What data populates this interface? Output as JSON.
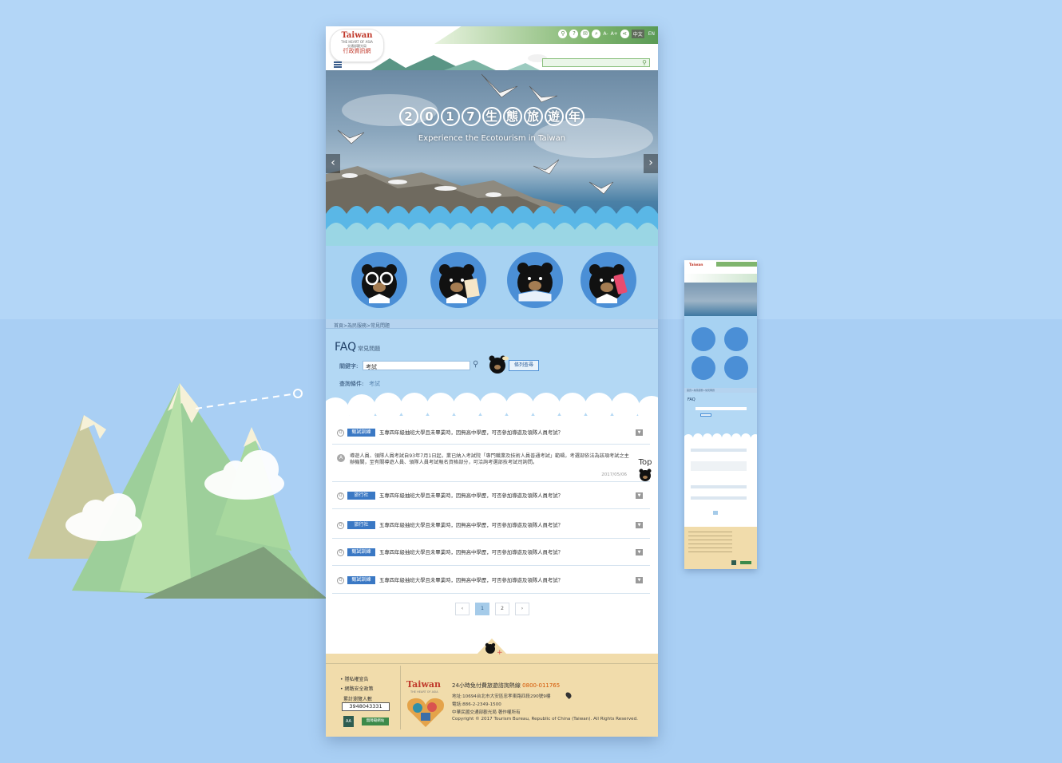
{
  "header": {
    "logo_title": "Taiwan",
    "logo_sub": "THE HEART OF ASIA",
    "logo_sub2": "交通部觀光局",
    "logo_caption": "行政資訊網",
    "lang_zh": "中文",
    "lang_en": "EN",
    "font_small": "A-",
    "font_large": "A+",
    "search_placeholder": ""
  },
  "hero": {
    "title_chars": [
      "2",
      "0",
      "1",
      "7",
      "生",
      "態",
      "旅",
      "遊",
      "年"
    ],
    "subtitle": "Experience the Ecotourism in Taiwan",
    "prev": "‹",
    "next": "›"
  },
  "breadcrumb": "首頁>為民服務>常見問題",
  "faq": {
    "title": "FAQ",
    "subtitle": "常見問題",
    "keyword_label": "關鍵字:",
    "keyword_value": "考試",
    "operation_label": "查詢條件:",
    "operation_value": "考試",
    "list_button": "條列查尋",
    "items": [
      {
        "tag": "甄試訓練",
        "question": "五專四年級抽班大學且未畢業時，因無高中學歷，可否參加導遊及領隊人員考試？"
      },
      {
        "tag": "旅行社",
        "question": "五專四年級抽班大學且未畢業時，因無高中學歷，可否參加導遊及領隊人員考試？"
      },
      {
        "tag": "旅行社",
        "question": "五專四年級抽班大學且未畢業時，因無高中學歷，可否參加導遊及領隊人員考試？"
      },
      {
        "tag": "甄試訓練",
        "question": "五專四年級抽班大學且未畢業時，因無高中學歷，可否參加導遊及領隊人員考試？"
      },
      {
        "tag": "甄試訓練",
        "question": "五專四年級抽班大學且未畢業時，因無高中學歷，可否參加導遊及領隊人員考試？"
      }
    ],
    "answer": {
      "text": "導遊人員、領隊人員考試自93年7月1日起，業已納入考試院「專門職業及技術人員普通考試」範疇，考選部依法為該項考試之主辦機關，至有關導遊人員、領隊人員考試報名資格部分，可洽詢考選部技考試司詢問。",
      "date": "2017/05/06"
    },
    "top_label": "Top",
    "q_mark": "Q",
    "a_mark": "A",
    "toggle_symbol": "▼"
  },
  "pagination": {
    "prev": "‹",
    "pages": [
      "1",
      "2"
    ],
    "next": "›",
    "active": "1"
  },
  "footer": {
    "links": [
      "隱私權宣告",
      "網路安全政策"
    ],
    "counter_label": "累計瀏覽人數",
    "counter_value": "3948043331",
    "logo": "Taiwan",
    "logo_sub": "THE HEART OF ASIA",
    "hotline_label": "24小時免付費旅遊諮詢熱線",
    "hotline_number": "0800-011765",
    "address": "地址:10694台北市大安區忠孝東路四段290號9樓",
    "phone": "電話:886-2-2349-1500",
    "owner": "中華民國交通部觀光局 著作權所有",
    "copyright": "Copyright © 2017 Tourism Bureau, Republic of China (Taiwan). All Rights Reserved.",
    "badge1": "AA",
    "badge2": "無障礙網站"
  },
  "colors": {
    "background": "#b3d6f7",
    "accent_blue": "#3a78c4",
    "footer": "#f1dcab",
    "bear_circle": "#4b8fd6"
  }
}
